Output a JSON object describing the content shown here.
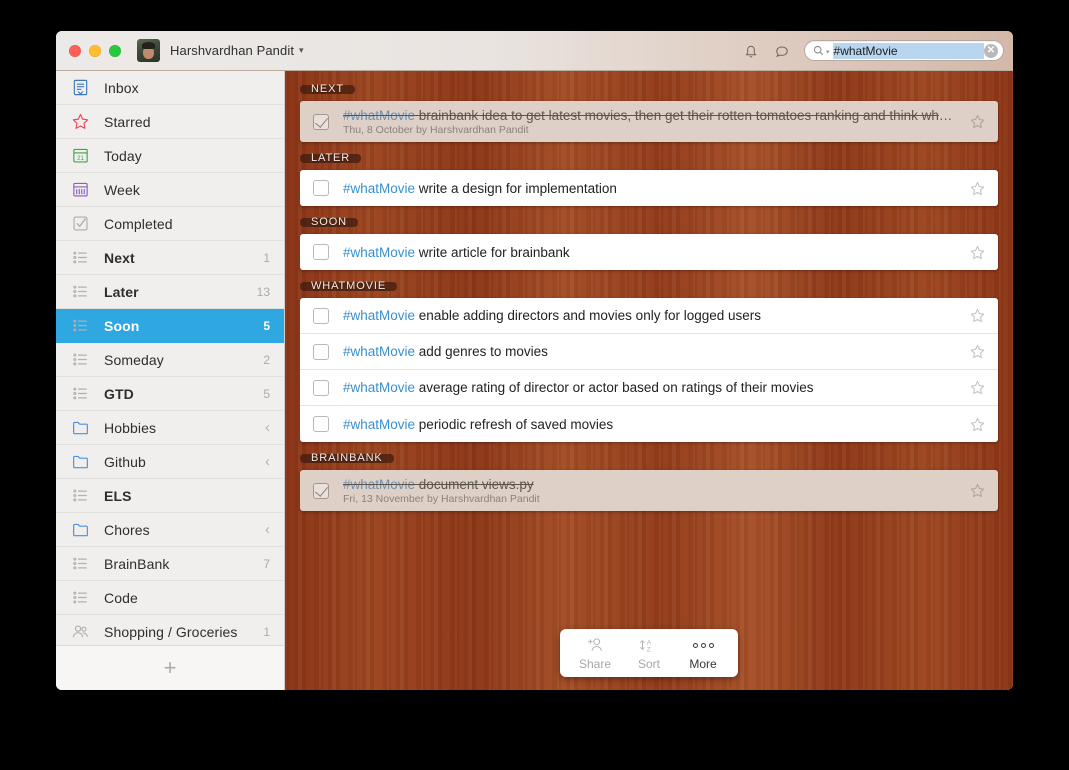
{
  "window": {
    "user_name": "Harshvardhan Pandit",
    "user_caret": "▾",
    "search_value": "#whatMovie",
    "search_placeholder": "Search",
    "search_caret": "▾",
    "clear_glyph": "✕"
  },
  "sidebar": {
    "items": [
      {
        "label": "Inbox",
        "icon": "inbox-icon",
        "count": "",
        "chevron": "",
        "bold": false,
        "selected": false
      },
      {
        "label": "Starred",
        "icon": "star-icon",
        "count": "",
        "chevron": "",
        "bold": false,
        "selected": false
      },
      {
        "label": "Today",
        "icon": "calendar-icon",
        "count": "",
        "chevron": "",
        "bold": false,
        "selected": false
      },
      {
        "label": "Week",
        "icon": "week-icon",
        "count": "",
        "chevron": "",
        "bold": false,
        "selected": false
      },
      {
        "label": "Completed",
        "icon": "check-icon",
        "count": "",
        "chevron": "",
        "bold": false,
        "selected": false
      },
      {
        "label": "Next",
        "icon": "list-icon",
        "count": "1",
        "chevron": "",
        "bold": true,
        "selected": false
      },
      {
        "label": "Later",
        "icon": "list-icon",
        "count": "13",
        "chevron": "",
        "bold": true,
        "selected": false
      },
      {
        "label": "Soon",
        "icon": "list-icon",
        "count": "5",
        "chevron": "",
        "bold": true,
        "selected": true
      },
      {
        "label": "Someday",
        "icon": "list-icon",
        "count": "2",
        "chevron": "",
        "bold": false,
        "selected": false
      },
      {
        "label": "GTD",
        "icon": "list-icon",
        "count": "5",
        "chevron": "",
        "bold": true,
        "selected": false
      },
      {
        "label": "Hobbies",
        "icon": "folder-icon",
        "count": "",
        "chevron": "‹",
        "bold": false,
        "selected": false
      },
      {
        "label": "Github",
        "icon": "folder-icon",
        "count": "",
        "chevron": "‹",
        "bold": false,
        "selected": false
      },
      {
        "label": "ELS",
        "icon": "list-icon",
        "count": "",
        "chevron": "",
        "bold": true,
        "selected": false
      },
      {
        "label": "Chores",
        "icon": "folder-icon",
        "count": "",
        "chevron": "‹",
        "bold": false,
        "selected": false
      },
      {
        "label": "BrainBank",
        "icon": "list-icon",
        "count": "7",
        "chevron": "",
        "bold": false,
        "selected": false
      },
      {
        "label": "Code",
        "icon": "list-icon",
        "count": "",
        "chevron": "",
        "bold": false,
        "selected": false
      },
      {
        "label": "Shopping / Groceries",
        "icon": "people-icon",
        "count": "1",
        "chevron": "",
        "bold": false,
        "selected": false
      }
    ],
    "add_glyph": "+"
  },
  "main": {
    "sections": [
      {
        "label": "NEXT",
        "tasks": [
          {
            "tag": "#whatMovie",
            "text": " brainbank idea to get latest movies, then get their rotten tomatoes ranking and think whether...",
            "meta": "Thu, 8 October by Harshvardhan Pandit",
            "done": true,
            "starred": false
          }
        ]
      },
      {
        "label": "LATER",
        "tasks": [
          {
            "tag": "#whatMovie",
            "text": " write a design for implementation",
            "meta": "",
            "done": false,
            "starred": false
          }
        ]
      },
      {
        "label": "SOON",
        "tasks": [
          {
            "tag": "#whatMovie",
            "text": " write article for brainbank",
            "meta": "",
            "done": false,
            "starred": false
          }
        ]
      },
      {
        "label": "WHATMOVIE",
        "tasks": [
          {
            "tag": "#whatMovie",
            "text": " enable adding directors and movies only for logged users",
            "meta": "",
            "done": false,
            "starred": false
          },
          {
            "tag": "#whatMovie",
            "text": " add genres to movies",
            "meta": "",
            "done": false,
            "starred": false
          },
          {
            "tag": "#whatMovie",
            "text": " average rating of director or actor based on ratings of their movies",
            "meta": "",
            "done": false,
            "starred": false
          },
          {
            "tag": "#whatMovie",
            "text": " periodic refresh of saved movies",
            "meta": "",
            "done": false,
            "starred": false
          }
        ]
      },
      {
        "label": "BRAINBANK",
        "tasks": [
          {
            "tag": "#whatMovie",
            "text": " document views.py",
            "meta": "Fri, 13 November by Harshvardhan Pandit",
            "done": true,
            "starred": false
          }
        ]
      }
    ]
  },
  "toolbar": {
    "share_label": "Share",
    "sort_label": "Sort",
    "sort_glyph_top": "↑A",
    "sort_glyph_bottom": "↓Z",
    "more_label": "More"
  },
  "colors": {
    "accent_blue": "#2fa8e1",
    "tag_blue": "#3a8fd0",
    "wood_brown": "#9c4520",
    "section_badge": "#3e1c0e"
  }
}
